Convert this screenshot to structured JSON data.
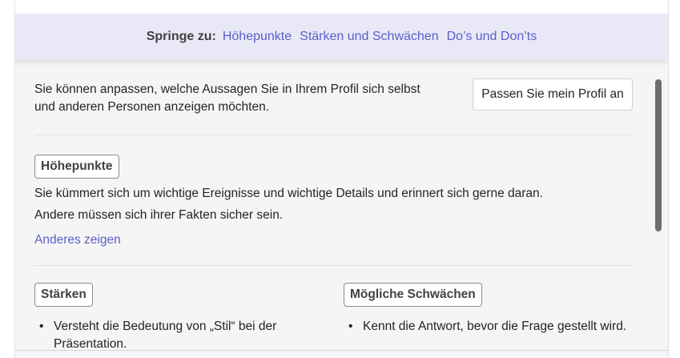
{
  "jump_bar": {
    "label": "Springe zu:",
    "links": [
      "Höhepunkte",
      "Stärken und Schwächen",
      "Do’s und Don’ts"
    ]
  },
  "intro": {
    "text": "Sie können anpassen, welche Aussagen Sie in Ihrem Profil sich selbst und anderen Personen anzeigen möchten.",
    "button_label": "Passen Sie mein Profil an"
  },
  "highlights": {
    "tag": "Höhepunkte",
    "text_line1": "Sie kümmert sich um wichtige Ereignisse und wichtige Details und erinnert sich gerne daran.",
    "text_line2": "Andere müssen sich ihrer Fakten sicher sein.",
    "show_more": "Anderes zeigen"
  },
  "strengths": {
    "tag": "Stärken",
    "items": [
      "Versteht die Bedeutung von „Stil“ bei der Präsentation."
    ]
  },
  "weaknesses": {
    "tag": "Mögliche Schwächen",
    "items": [
      "Kennt die Antwort, bevor die Frage gestellt wird."
    ]
  },
  "colors": {
    "accent": "#5b5fc7",
    "jump_bar_bg": "#e8e8f7",
    "card_bg": "#f5f5f5"
  }
}
